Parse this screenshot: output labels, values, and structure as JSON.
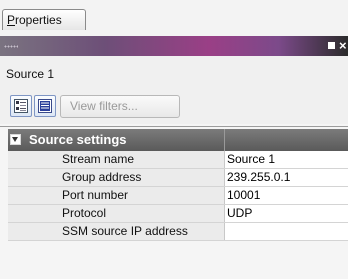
{
  "tab": {
    "label": "Properties",
    "label_first": "P",
    "label_rest": "roperties"
  },
  "panel": {
    "title": "Source 1"
  },
  "titlebar": {
    "colors": [
      "#7a7380",
      "#9a3f86",
      "#2b2b2b"
    ],
    "close_glyph": "×"
  },
  "toolbar": {
    "categorized_icon": "categorized-view-icon",
    "alphabetical_icon": "alphabetical-view-icon",
    "view_filters_label": "View filters..."
  },
  "group": {
    "label": "Source settings",
    "expanded": true
  },
  "properties": [
    {
      "name": "Stream name",
      "value": "Source 1"
    },
    {
      "name": "Group address",
      "value": "239.255.0.1"
    },
    {
      "name": "Port number",
      "value": "10001"
    },
    {
      "name": "Protocol",
      "value": "UDP"
    },
    {
      "name": "SSM source IP address",
      "value": ""
    }
  ]
}
